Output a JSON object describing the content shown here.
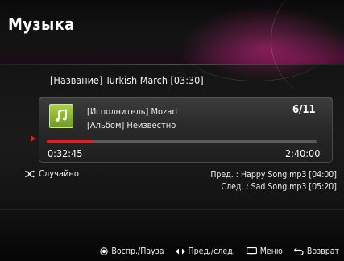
{
  "header": {
    "title": "Музыка"
  },
  "song": {
    "title": "[Название] Turkish March [03:30]"
  },
  "player": {
    "artist": "[Исполнитель] Mozart",
    "album": "[Альбом] Неизвестно",
    "counter": "6/11",
    "current_time": "0:32:45",
    "total_time": "2:40:00",
    "progress_fraction": 0.17,
    "progress_color": "#e02020",
    "album_art_icon": "music-note-icon"
  },
  "shuffle": {
    "label": "Случайно",
    "icon": "shuffle-icon"
  },
  "queue": {
    "prev": "Пред. : Happy Song.mp3 [04:00]",
    "next": "След. : Sad Song.mp3 [05:20]"
  },
  "footer": {
    "play_pause": "Воспр./Пауза",
    "prev_next": "Пред./след.",
    "menu": "Меню",
    "back": "Возврат"
  }
}
